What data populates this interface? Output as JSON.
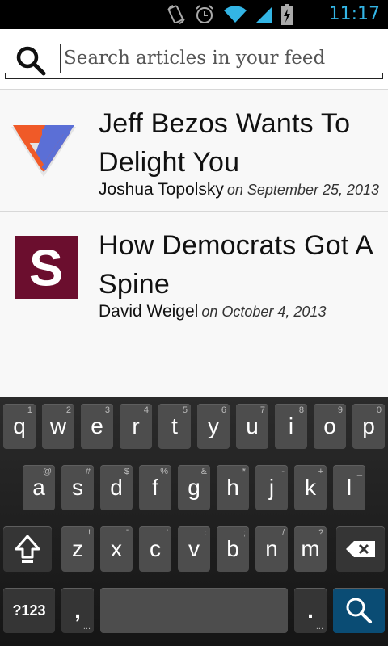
{
  "status_bar": {
    "time": "11:17",
    "icons": [
      "rotate-icon",
      "alarm-icon",
      "wifi-icon",
      "signal-icon",
      "battery-charging-icon"
    ],
    "accent": "#33b5e5"
  },
  "search": {
    "placeholder": "Search articles in your feed",
    "value": ""
  },
  "articles": [
    {
      "title": "Jeff Bezos Wants To Delight You",
      "author": "Joshua Topolsky",
      "date": "on September 25, 2013",
      "source_icon": "the-verge-logo-icon"
    },
    {
      "title": "How Democrats Got A Spine",
      "author": "David Weigel",
      "date": "on October 4, 2013",
      "source_icon": "slate-logo-icon"
    }
  ],
  "keyboard": {
    "row1": [
      {
        "ch": "q",
        "hint": "1"
      },
      {
        "ch": "w",
        "hint": "2"
      },
      {
        "ch": "e",
        "hint": "3"
      },
      {
        "ch": "r",
        "hint": "4"
      },
      {
        "ch": "t",
        "hint": "5"
      },
      {
        "ch": "y",
        "hint": "6"
      },
      {
        "ch": "u",
        "hint": "7"
      },
      {
        "ch": "i",
        "hint": "8"
      },
      {
        "ch": "o",
        "hint": "9"
      },
      {
        "ch": "p",
        "hint": "0"
      }
    ],
    "row2": [
      {
        "ch": "a",
        "hint": "@"
      },
      {
        "ch": "s",
        "hint": "#"
      },
      {
        "ch": "d",
        "hint": "$"
      },
      {
        "ch": "f",
        "hint": "%"
      },
      {
        "ch": "g",
        "hint": "&"
      },
      {
        "ch": "h",
        "hint": "*"
      },
      {
        "ch": "j",
        "hint": "-"
      },
      {
        "ch": "k",
        "hint": "+"
      },
      {
        "ch": "l",
        "hint": "_"
      }
    ],
    "row3": [
      {
        "ch": "z",
        "hint": "!"
      },
      {
        "ch": "x",
        "hint": "\""
      },
      {
        "ch": "c",
        "hint": "'"
      },
      {
        "ch": "v",
        "hint": ":"
      },
      {
        "ch": "b",
        "hint": ";"
      },
      {
        "ch": "n",
        "hint": "/"
      },
      {
        "ch": "m",
        "hint": "?"
      }
    ],
    "symbols_label": "?123",
    "comma": ",",
    "period": ".",
    "comma_hint": "...",
    "period_hint": "..."
  },
  "colors": {
    "enter_key": "#0a4c74",
    "verge_orange": "#f05a28",
    "verge_blue": "#5b6fd6",
    "slate_maroon": "#6b0e2e"
  }
}
